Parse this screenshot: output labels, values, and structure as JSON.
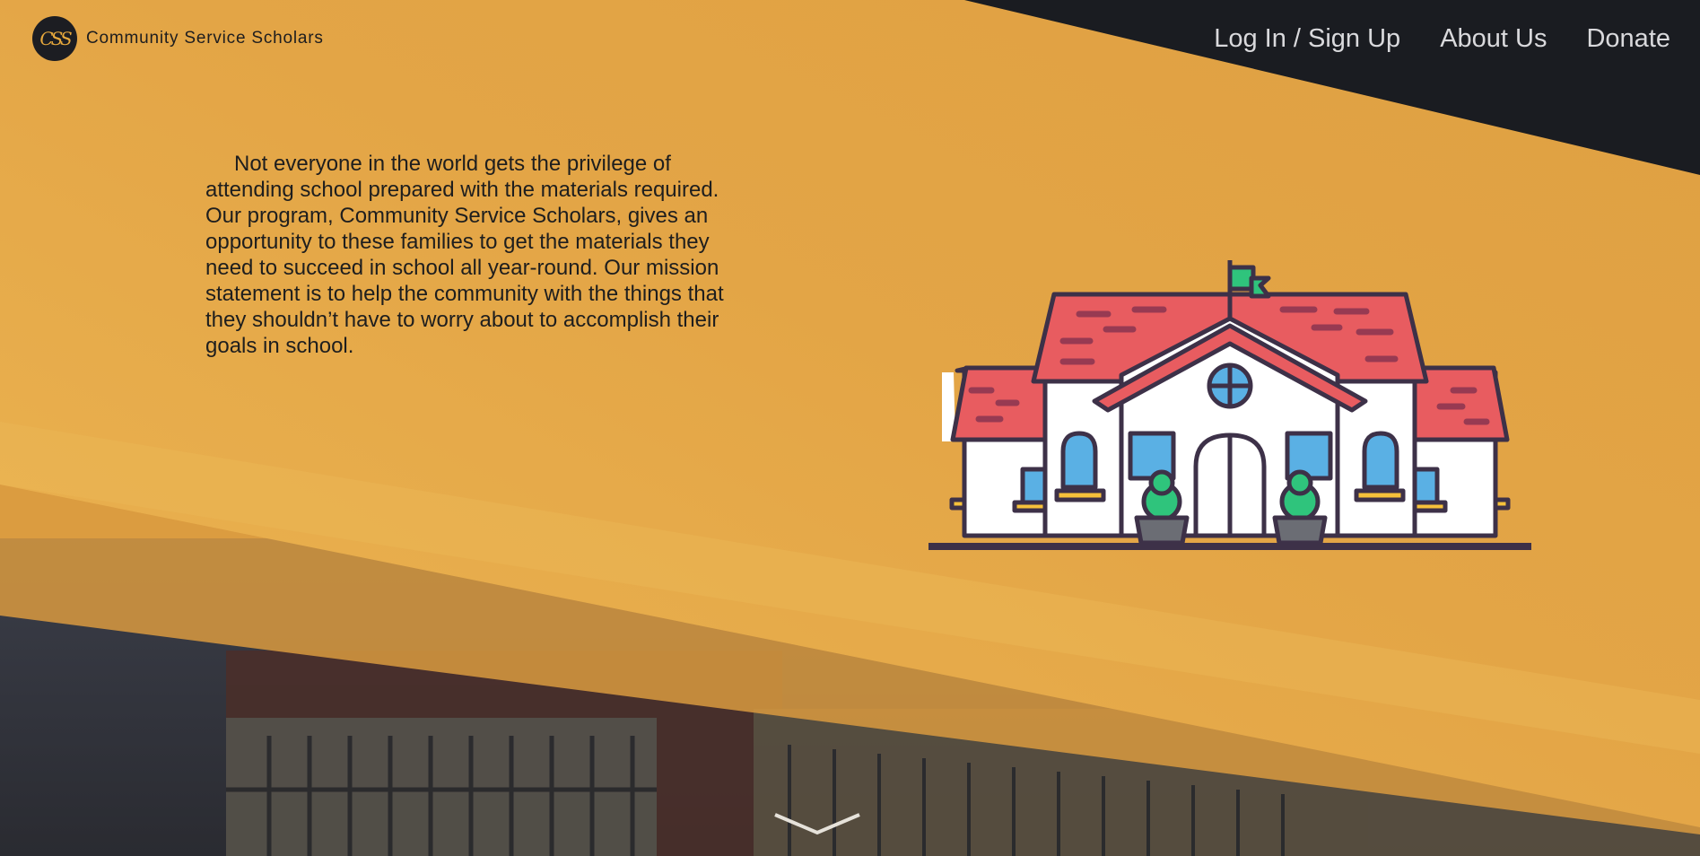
{
  "brand": {
    "logo_text": "CSS",
    "name": "Community Service Scholars"
  },
  "nav": {
    "items": [
      {
        "label": "Log In / Sign Up"
      },
      {
        "label": "About Us"
      },
      {
        "label": "Donate"
      }
    ]
  },
  "hero": {
    "mission_text": "Not everyone in the world gets the privilege of attending school prepared with the materials required. Our program, Community Service Scholars, gives an opportunity to these families to get the materials they need to succeed in school all year-round. Our mission statement is to help the community with the things that they shouldn’t have to worry about to accomplish their goals in school."
  },
  "icons": {
    "school": "school-building-icon",
    "scroll": "chevron-down-icon"
  },
  "colors": {
    "accent_yellow": "#e6aa48",
    "dark": "#1a1c21",
    "nav_text": "#d9d9dc",
    "roof_red": "#e85c60",
    "window_blue": "#5ab0e4",
    "bush_green": "#2fc47c"
  }
}
